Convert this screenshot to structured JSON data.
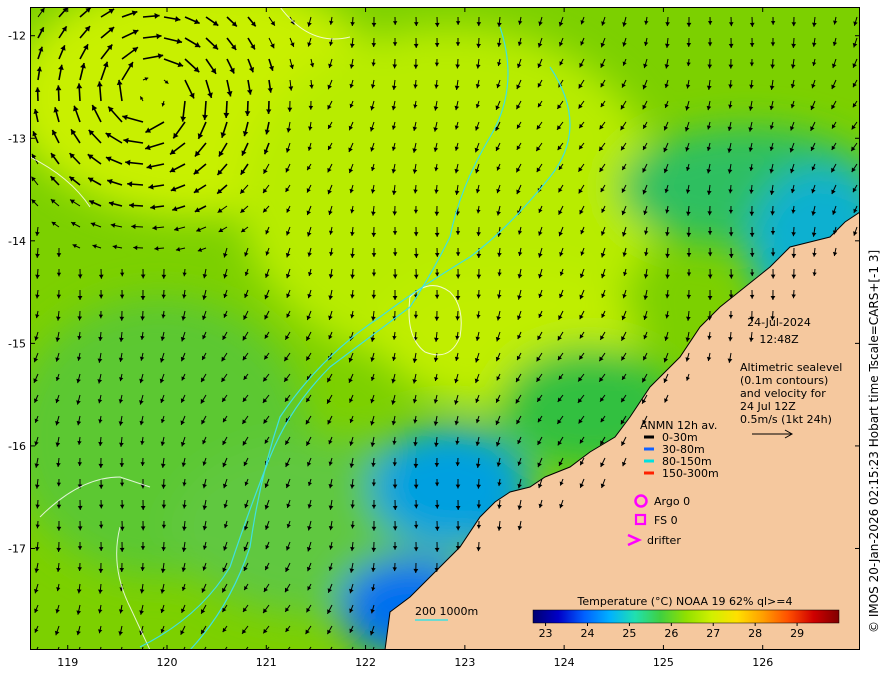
{
  "map": {
    "lon_labels": [
      "119",
      "120",
      "121",
      "122",
      "123",
      "124",
      "125",
      "126"
    ],
    "lat_labels": [
      "-12",
      "-13",
      "-14",
      "-15",
      "-16",
      "-17"
    ],
    "lon_values": [
      119,
      120,
      121,
      122,
      123,
      124,
      125,
      126
    ],
    "lat_values": [
      -12,
      -13,
      -14,
      -15,
      -16,
      -17
    ],
    "lon_range": [
      118.62,
      126.98
    ],
    "lat_range": [
      -17.99,
      -11.72
    ],
    "land_color": "#f5c89e",
    "ocean_colors": {
      "warm": "#c8f000",
      "mid": "#8fd800",
      "cool": "#3fc040",
      "cold": "#00a0e0"
    }
  },
  "header": {
    "date": "24-Jul-2024",
    "time": "12:48Z"
  },
  "description": {
    "line1": "Altimetric sealevel",
    "line2": "(0.1m contours)",
    "line3": "and velocity for",
    "line4": "24 Jul 12Z",
    "line5": "0.5m/s (1kt 24h)"
  },
  "legend": {
    "title": "ANMN 12h av.",
    "items": [
      {
        "label": "0-30m",
        "color": "#000000"
      },
      {
        "label": "30-80m",
        "color": "#1060ff"
      },
      {
        "label": "80-150m",
        "color": "#00e0e0"
      },
      {
        "label": "150-300m",
        "color": "#ff2000"
      }
    ],
    "argo": "Argo 0",
    "fs": "FS 0",
    "drifter": "drifter",
    "marker_color": "#ff00ff"
  },
  "colorbar": {
    "title": "Temperature (°C) NOAA 19 62% ql>=4",
    "ticks": [
      "23",
      "24",
      "25",
      "26",
      "27",
      "28",
      "29"
    ],
    "range": [
      22.7,
      30.0
    ],
    "colors": [
      "#00006f",
      "#0000c8",
      "#0060ff",
      "#00b0ff",
      "#20e0b0",
      "#40d040",
      "#90e000",
      "#d0f000",
      "#ffe000",
      "#ffa000",
      "#ff5000",
      "#d00000",
      "#800000"
    ]
  },
  "isobath": {
    "label": "200  1000m",
    "color": "#40e0e0"
  },
  "credit": "© IMOS 20-Jan-2026 02:15:23 Hobart time Tscale=CARS+[-1 3]"
}
